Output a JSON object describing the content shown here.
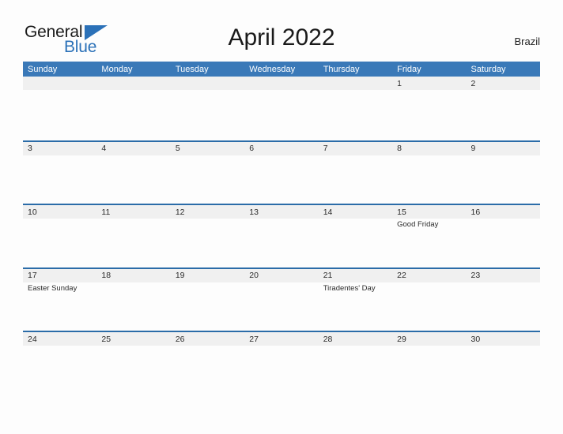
{
  "brand": {
    "name_top": "General",
    "name_bottom": "Blue",
    "top_color": "#1a1a1a",
    "bottom_color": "#2b71b8"
  },
  "header": {
    "title": "April 2022",
    "region": "Brazil"
  },
  "colors": {
    "header_blue": "#3a79b8",
    "row_divider": "#2b6ca8",
    "day_band_gray": "#f0f0f0",
    "page_background": "#fdfdfd",
    "text": "#2b2b2b"
  },
  "calendar": {
    "weekdays": [
      "Sunday",
      "Monday",
      "Tuesday",
      "Wednesday",
      "Thursday",
      "Friday",
      "Saturday"
    ],
    "weeks": [
      {
        "days": [
          {
            "date": "",
            "event": ""
          },
          {
            "date": "",
            "event": ""
          },
          {
            "date": "",
            "event": ""
          },
          {
            "date": "",
            "event": ""
          },
          {
            "date": "",
            "event": ""
          },
          {
            "date": "1",
            "event": ""
          },
          {
            "date": "2",
            "event": ""
          }
        ]
      },
      {
        "days": [
          {
            "date": "3",
            "event": ""
          },
          {
            "date": "4",
            "event": ""
          },
          {
            "date": "5",
            "event": ""
          },
          {
            "date": "6",
            "event": ""
          },
          {
            "date": "7",
            "event": ""
          },
          {
            "date": "8",
            "event": ""
          },
          {
            "date": "9",
            "event": ""
          }
        ]
      },
      {
        "days": [
          {
            "date": "10",
            "event": ""
          },
          {
            "date": "11",
            "event": ""
          },
          {
            "date": "12",
            "event": ""
          },
          {
            "date": "13",
            "event": ""
          },
          {
            "date": "14",
            "event": ""
          },
          {
            "date": "15",
            "event": "Good Friday"
          },
          {
            "date": "16",
            "event": ""
          }
        ]
      },
      {
        "days": [
          {
            "date": "17",
            "event": "Easter Sunday"
          },
          {
            "date": "18",
            "event": ""
          },
          {
            "date": "19",
            "event": ""
          },
          {
            "date": "20",
            "event": ""
          },
          {
            "date": "21",
            "event": "Tiradentes' Day"
          },
          {
            "date": "22",
            "event": ""
          },
          {
            "date": "23",
            "event": ""
          }
        ]
      },
      {
        "days": [
          {
            "date": "24",
            "event": ""
          },
          {
            "date": "25",
            "event": ""
          },
          {
            "date": "26",
            "event": ""
          },
          {
            "date": "27",
            "event": ""
          },
          {
            "date": "28",
            "event": ""
          },
          {
            "date": "29",
            "event": ""
          },
          {
            "date": "30",
            "event": ""
          }
        ]
      }
    ]
  }
}
